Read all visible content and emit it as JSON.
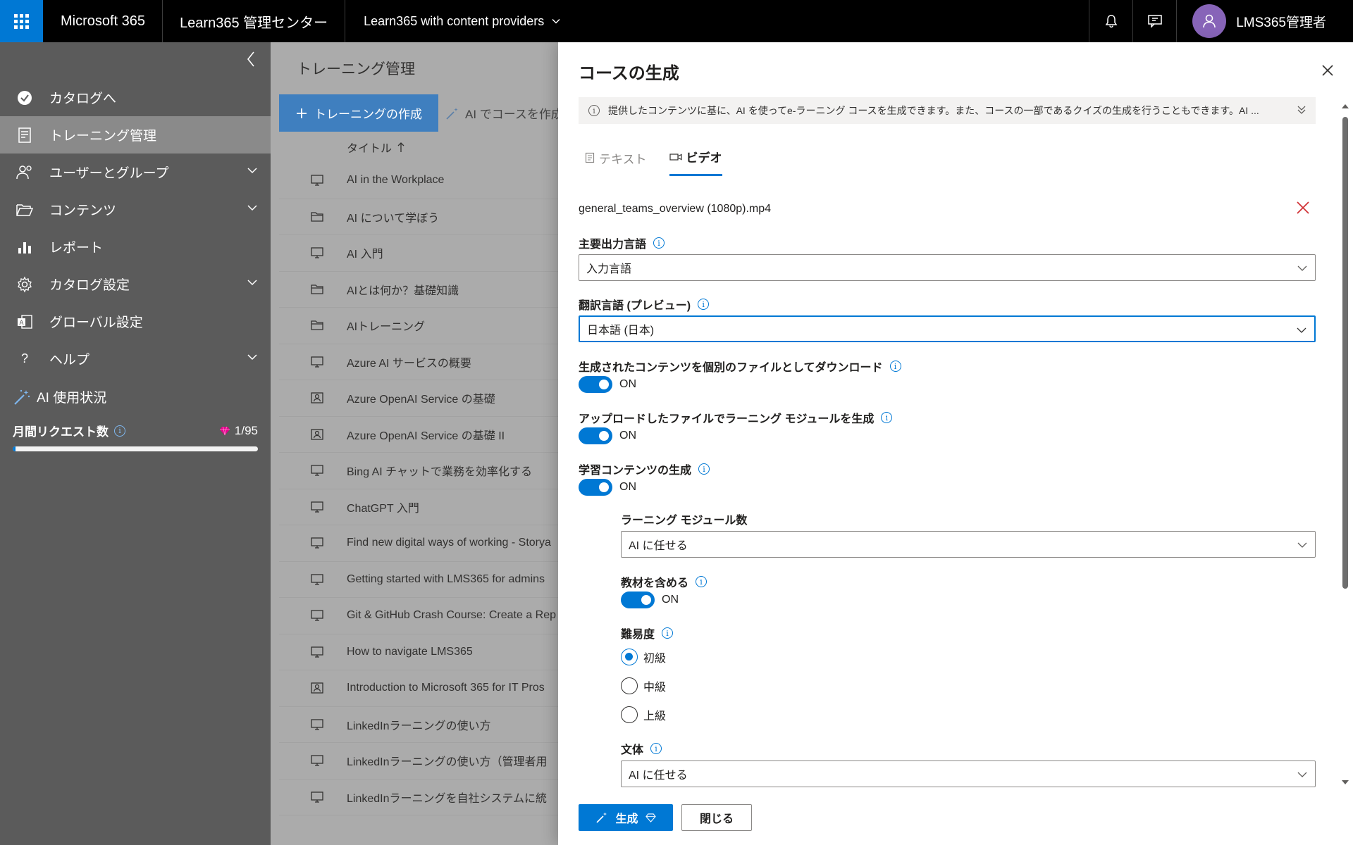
{
  "topbar": {
    "brand": "Microsoft 365",
    "app": "Learn365 管理センター",
    "env": "Learn365 with content providers",
    "user": "LMS365管理者"
  },
  "sidebar": {
    "items": [
      {
        "label": "カタログへ",
        "icon": "catalog-check-icon",
        "chevron": false,
        "active": false
      },
      {
        "label": "トレーニング管理",
        "icon": "training-icon",
        "chevron": false,
        "active": true
      },
      {
        "label": "ユーザーとグループ",
        "icon": "users-icon",
        "chevron": true,
        "active": false
      },
      {
        "label": "コンテンツ",
        "icon": "folder-open-icon",
        "chevron": true,
        "active": false
      },
      {
        "label": "レポート",
        "icon": "chart-icon",
        "chevron": false,
        "active": false
      },
      {
        "label": "カタログ設定",
        "icon": "gear-icon",
        "chevron": true,
        "active": false
      },
      {
        "label": "グローバル設定",
        "icon": "admin-icon",
        "chevron": false,
        "active": false
      },
      {
        "label": "ヘルプ",
        "icon": "help-icon",
        "chevron": true,
        "active": false
      }
    ],
    "ai_usage": {
      "title": "AI 使用状況",
      "monthly_label": "月間リクエスト数",
      "count": "1/95",
      "progress": 0.0105
    }
  },
  "main": {
    "title": "トレーニング管理",
    "create_button": "トレーニングの作成",
    "ai_button": "AI でコースを作成",
    "column_title": "タイトル",
    "rows": [
      {
        "title": "AI in the Workplace",
        "icon": "course"
      },
      {
        "title": "AI について学ぼう",
        "icon": "folder"
      },
      {
        "title": "AI 入門",
        "icon": "course"
      },
      {
        "title": "AIとは何か？基礎知識",
        "icon": "folder"
      },
      {
        "title": "AIトレーニング",
        "icon": "folder"
      },
      {
        "title": "Azure AI サービスの概要",
        "icon": "course"
      },
      {
        "title": "Azure OpenAI Service の基礎",
        "icon": "person"
      },
      {
        "title": "Azure OpenAI Service の基礎 II",
        "icon": "person"
      },
      {
        "title": "Bing AI チャットで業務を効率化する",
        "icon": "course"
      },
      {
        "title": "ChatGPT 入門",
        "icon": "course"
      },
      {
        "title": "Find new digital ways of working - Storya",
        "icon": "course"
      },
      {
        "title": "Getting started with LMS365 for admins",
        "icon": "course"
      },
      {
        "title": "Git & GitHub Crash Course: Create a Rep",
        "icon": "course"
      },
      {
        "title": "How to navigate LMS365",
        "icon": "course"
      },
      {
        "title": "Introduction to Microsoft 365 for IT Pros",
        "icon": "person"
      },
      {
        "title": "LinkedInラーニングの使い方",
        "icon": "course"
      },
      {
        "title": "LinkedInラーニングの使い方（管理者用",
        "icon": "course"
      },
      {
        "title": "LinkedInラーニングを自社システムに統",
        "icon": "course"
      }
    ]
  },
  "panel": {
    "title": "コースの生成",
    "info": "提供したコンテンツに基に、AI を使ってe-ラーニング コースを生成できます。また、コースの一部であるクイズの生成を行うこともできます。AI ...",
    "tabs": [
      {
        "label": "テキスト",
        "selected": false
      },
      {
        "label": "ビデオ",
        "selected": true
      }
    ],
    "file_name": "general_teams_overview (1080p).mp4",
    "primary_language": {
      "label": "主要出力言語",
      "value": "入力言語"
    },
    "translation_language": {
      "label": "翻訳言語 (プレビュー)",
      "value": "日本語 (日本)"
    },
    "download_separate": {
      "label": "生成されたコンテンツを個別のファイルとしてダウンロード",
      "state": "ON"
    },
    "generate_module": {
      "label": "アップロードしたファイルでラーニング モジュールを生成",
      "state": "ON"
    },
    "generate_learning": {
      "label": "学習コンテンツの生成",
      "state": "ON"
    },
    "module_count": {
      "label": "ラーニング モジュール数",
      "value": "AI に任せる"
    },
    "include_material": {
      "label": "教材を含める",
      "state": "ON"
    },
    "difficulty": {
      "label": "難易度",
      "options": [
        "初級",
        "中級",
        "上級"
      ],
      "selected": "初級"
    },
    "style": {
      "label": "文体",
      "value": "AI に任せる"
    },
    "generate_button": "生成",
    "close_button": "閉じる"
  },
  "colors": {
    "accent": "#0078d4",
    "topbar": "#000000",
    "sidebar": "#5b5b5b",
    "sidebar_active": "#8a8a8a",
    "error": "#d13438",
    "gem": "#e3008c"
  }
}
